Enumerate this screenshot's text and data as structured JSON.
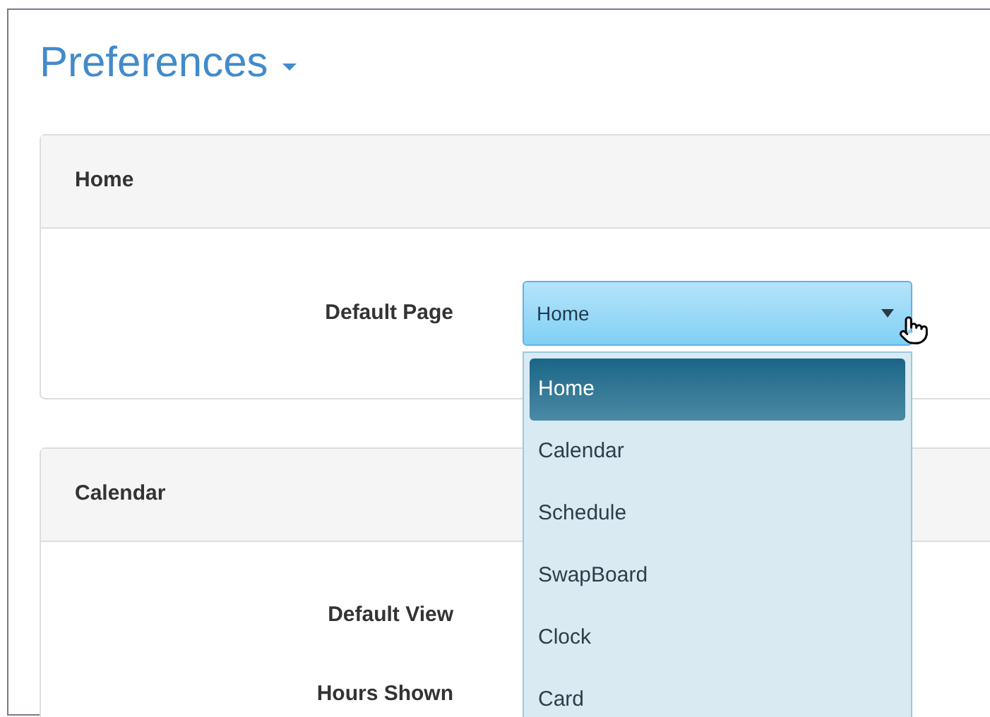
{
  "title": "Preferences",
  "sections": [
    {
      "heading": "Home",
      "fields": [
        {
          "label": "Default Page",
          "kind": "select",
          "value": "Home",
          "open": true,
          "options": [
            {
              "label": "Home",
              "selected": true
            },
            {
              "label": "Calendar",
              "selected": false
            },
            {
              "label": "Schedule",
              "selected": false
            },
            {
              "label": "SwapBoard",
              "selected": false
            },
            {
              "label": "Clock",
              "selected": false
            },
            {
              "label": "Card",
              "selected": false
            }
          ]
        }
      ]
    },
    {
      "heading": "Calendar",
      "fields": [
        {
          "label": "Default View",
          "kind": "label"
        },
        {
          "label": "Hours Shown",
          "kind": "label"
        }
      ]
    }
  ]
}
